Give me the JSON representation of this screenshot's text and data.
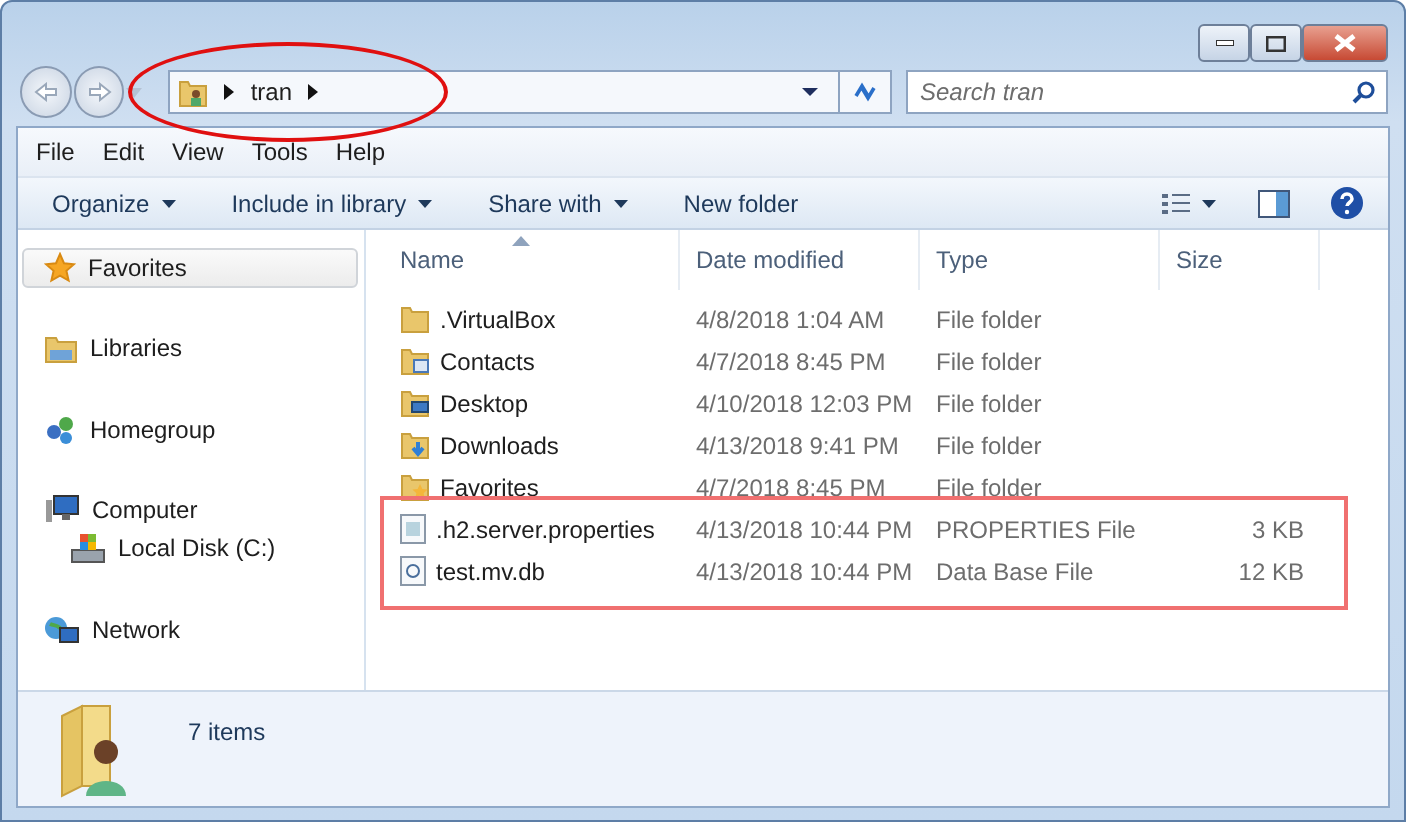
{
  "address": {
    "crumbs": [
      "tran"
    ]
  },
  "search": {
    "placeholder": "Search tran"
  },
  "menu": [
    "File",
    "Edit",
    "View",
    "Tools",
    "Help"
  ],
  "commands": [
    {
      "label": "Organize",
      "dropdown": true
    },
    {
      "label": "Include in library",
      "dropdown": true
    },
    {
      "label": "Share with",
      "dropdown": true
    },
    {
      "label": "New folder",
      "dropdown": false
    }
  ],
  "nav": [
    {
      "label": "Favorites",
      "kind": "favorites",
      "selected": true
    },
    {
      "label": "Libraries",
      "kind": "libraries",
      "selected": false
    },
    {
      "label": "Homegroup",
      "kind": "homegroup",
      "selected": false
    },
    {
      "label": "Computer",
      "kind": "computer",
      "selected": false,
      "children": [
        {
          "label": "Local Disk (C:)",
          "kind": "disk",
          "selected": false
        }
      ]
    },
    {
      "label": "Network",
      "kind": "network",
      "selected": false
    }
  ],
  "columns": [
    {
      "label": "Name",
      "sorted": true
    },
    {
      "label": "Date modified",
      "sorted": false
    },
    {
      "label": "Type",
      "sorted": false
    },
    {
      "label": "Size",
      "sorted": false
    }
  ],
  "rows": [
    {
      "name": ".VirtualBox",
      "date": "4/8/2018 1:04 AM",
      "type": "File folder",
      "kind": "folder",
      "highlighted": false
    },
    {
      "name": "Contacts",
      "date": "4/7/2018 8:45 PM",
      "type": "File folder",
      "kind": "contacts",
      "highlighted": false
    },
    {
      "name": "Desktop",
      "date": "4/10/2018 12:03 PM",
      "type": "File folder",
      "kind": "desktop",
      "highlighted": false
    },
    {
      "name": "Downloads",
      "date": "4/13/2018 9:41 PM",
      "type": "File folder",
      "kind": "downloads",
      "highlighted": false
    },
    {
      "name": "Favorites",
      "date": "4/7/2018 8:45 PM",
      "type": "File folder",
      "kind": "favorites",
      "highlighted": false
    },
    {
      "name": ".h2.server.properties",
      "date": "4/13/2018 10:44 PM",
      "type": "PROPERTIES File",
      "size": "3 KB",
      "kind": "file",
      "highlighted": true
    },
    {
      "name": "test.mv.db",
      "date": "4/13/2018 10:44 PM",
      "type": "Data Base File",
      "size": "12 KB",
      "kind": "db",
      "highlighted": true
    }
  ],
  "status": {
    "count": "7 items"
  },
  "address_circled": true
}
